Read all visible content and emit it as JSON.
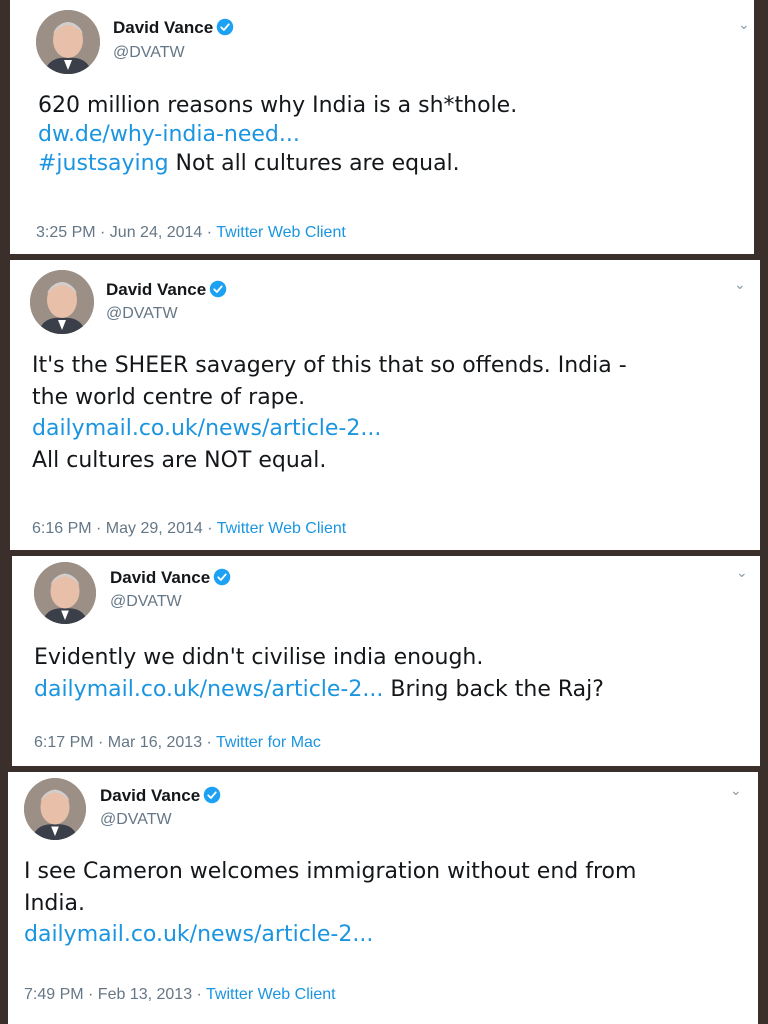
{
  "tweets": [
    {
      "name": "David Vance",
      "handle": "@DVATW",
      "text_line1": "620 million reasons why India is a sh*thole.",
      "link": "dw.de/why-india-need...",
      "hashtag": "#justsaying",
      "text_after": " Not all cultures are equal.",
      "time": "3:25 PM · Jun 24, 2014 · ",
      "client": "Twitter Web Client"
    },
    {
      "name": "David Vance",
      "handle": "@DVATW",
      "text_line1": "It's the SHEER savagery of this that so offends. India -",
      "text_line2": "the world centre of rape.",
      "link": "dailymail.co.uk/news/article-2...",
      "text_line4": "All cultures are NOT equal.",
      "time": "6:16 PM · May 29, 2014 · ",
      "client": "Twitter Web Client"
    },
    {
      "name": "David Vance",
      "handle": "@DVATW",
      "text_line1": "Evidently we didn't civilise india enough.",
      "link": "dailymail.co.uk/news/article-2...",
      "text_after": " Bring back the Raj?",
      "time": "6:17 PM · Mar 16, 2013 · ",
      "client": "Twitter for Mac"
    },
    {
      "name": "David Vance",
      "handle": "@DVATW",
      "text_line1": "I see Cameron welcomes immigration without end from",
      "text_line2": "India.",
      "link": "dailymail.co.uk/news/article-2...",
      "time": "7:49 PM · Feb 13, 2013 · ",
      "client": "Twitter Web Client"
    }
  ],
  "colors": {
    "link": "#1b95e0",
    "verified": "#1da1f2",
    "background": "#3a2f2b"
  },
  "icons": [
    "avatar",
    "verified-badge-icon",
    "chevron-down-icon"
  ]
}
